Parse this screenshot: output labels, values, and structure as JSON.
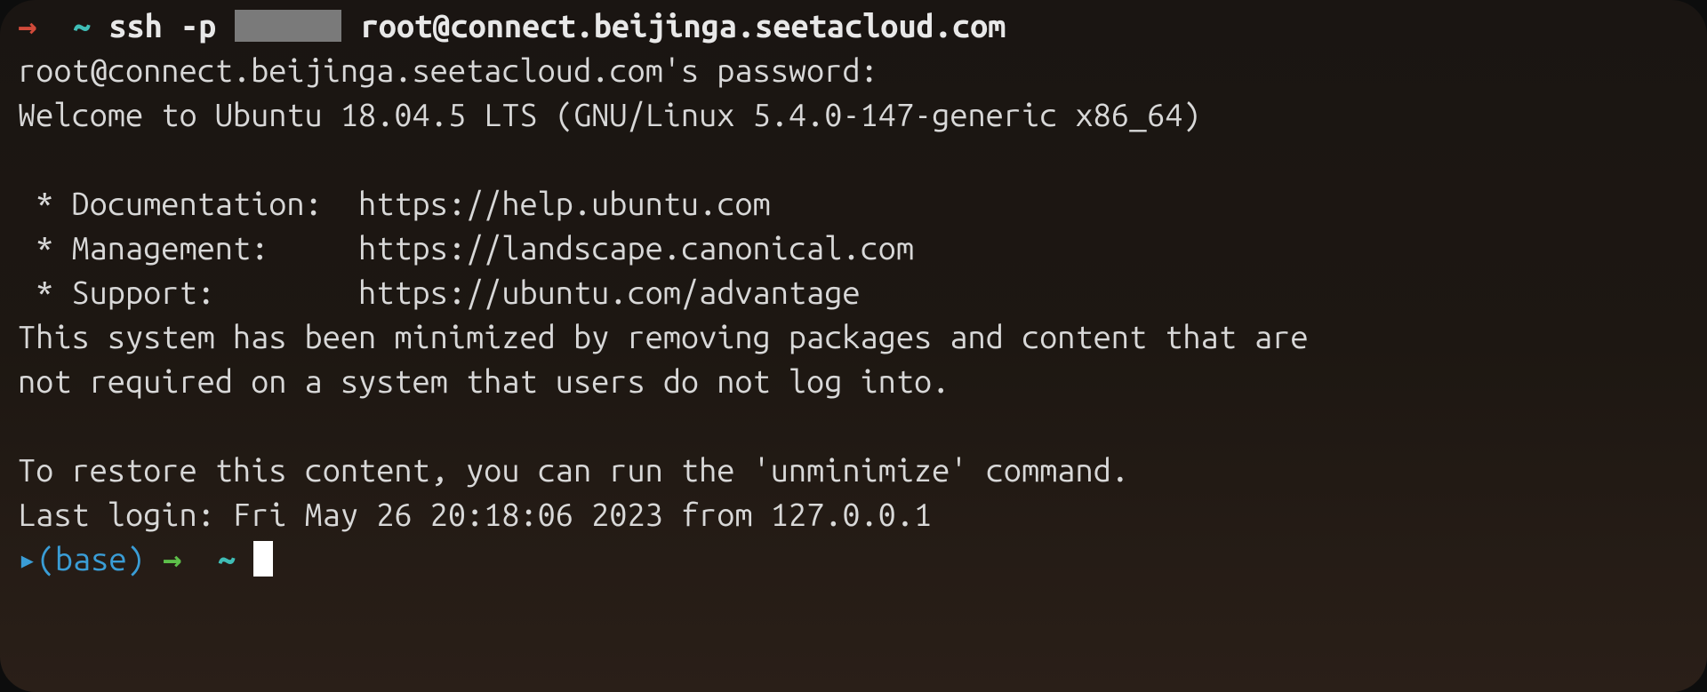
{
  "prompt1": {
    "arrow": "→",
    "tilde": "~",
    "cmd_prefix": "ssh -p ",
    "cmd_suffix": " root@connect.beijinga.seetacloud.com"
  },
  "password_prompt": "root@connect.beijinga.seetacloud.com's password:",
  "welcome": "Welcome to Ubuntu 18.04.5 LTS (GNU/Linux 5.4.0-147-generic x86_64)",
  "links": {
    "doc": " * Documentation:  https://help.ubuntu.com",
    "mgmt": " * Management:     https://landscape.canonical.com",
    "support": " * Support:        https://ubuntu.com/advantage"
  },
  "minimized1": "This system has been minimized by removing packages and content that are",
  "minimized2": "not required on a system that users do not log into.",
  "restore": "To restore this content, you can run the 'unminimize' command.",
  "last_login": "Last login: Fri May 26 20:18:06 2023 from 127.0.0.1",
  "prompt2": {
    "marker": "▸",
    "env": "(base)",
    "arrow": "→",
    "tilde": "~"
  }
}
